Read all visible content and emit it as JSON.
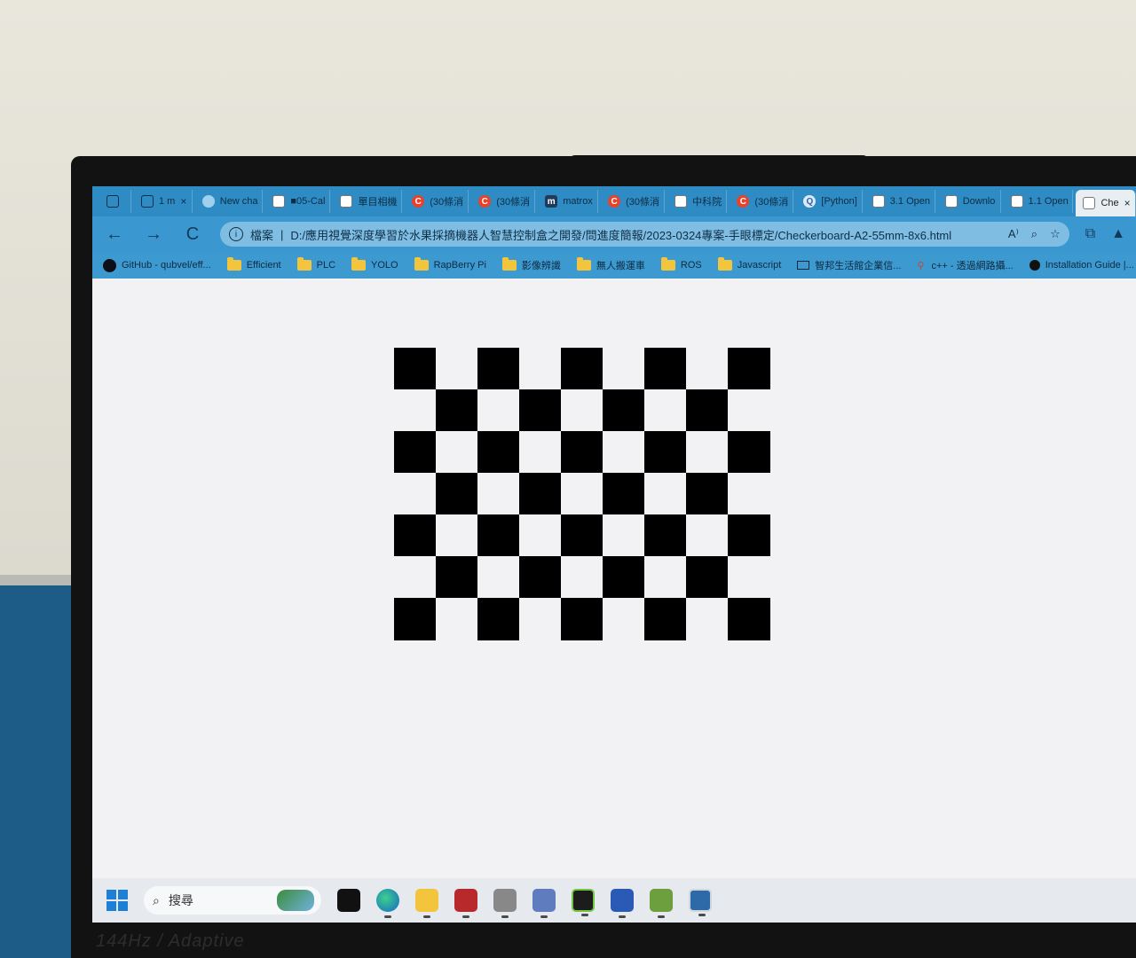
{
  "browser": {
    "tabs": [
      {
        "label": "",
        "icon": "window-switcher-icon",
        "active": false
      },
      {
        "label": "1 m",
        "icon": "book-icon",
        "active": false,
        "closable": true
      },
      {
        "label": "New cha",
        "icon": "globe-icon",
        "active": false
      },
      {
        "label": "■05-Cal",
        "icon": "document-icon",
        "active": false
      },
      {
        "label": "單目相機",
        "icon": "document-icon",
        "active": false
      },
      {
        "label": "(30條消",
        "icon": "csdn-icon",
        "active": false
      },
      {
        "label": "(30條消",
        "icon": "csdn-icon",
        "active": false
      },
      {
        "label": "matrox",
        "icon": "m-icon",
        "active": false
      },
      {
        "label": "(30條消",
        "icon": "csdn-icon",
        "active": false
      },
      {
        "label": "中科院",
        "icon": "document-icon",
        "active": false
      },
      {
        "label": "(30條消",
        "icon": "csdn-icon",
        "active": false
      },
      {
        "label": "[Python]",
        "icon": "q-icon",
        "active": false
      },
      {
        "label": "3.1 Open",
        "icon": "page-icon",
        "active": false
      },
      {
        "label": "Downlo",
        "icon": "page-icon",
        "active": false
      },
      {
        "label": "1.1 Open",
        "icon": "page-icon",
        "active": false
      },
      {
        "label": "Che",
        "icon": "document-icon",
        "active": true,
        "closable": true
      }
    ],
    "toolbar": {
      "back_icon": "←",
      "forward_icon": "→",
      "reload_icon": "C",
      "info_icon": "i",
      "scheme": "檔案",
      "separator": "|",
      "url": "D:/應用視覺深度學習於水果採摘機器人智慧控制盒之開發/問進度簡報/2023-0324專案-手眼標定/Checkerboard-A2-55mm-8x6.html",
      "read_aloud_icon": "A⁾",
      "zoom_icon": "⌕",
      "favorite_icon": "☆",
      "collections_icon": "⧉",
      "profile_icon": "▲"
    },
    "bookmarks": [
      {
        "label": "GitHub - qubvel/eff...",
        "icon": "github-icon"
      },
      {
        "label": "Efficient",
        "icon": "folder-icon"
      },
      {
        "label": "PLC",
        "icon": "folder-icon"
      },
      {
        "label": "YOLO",
        "icon": "folder-icon"
      },
      {
        "label": "RapBerry Pi",
        "icon": "folder-icon"
      },
      {
        "label": "影像辨識",
        "icon": "folder-icon"
      },
      {
        "label": "無人搬運車",
        "icon": "folder-icon"
      },
      {
        "label": "ROS",
        "icon": "folder-icon"
      },
      {
        "label": "Javascript",
        "icon": "folder-icon"
      },
      {
        "label": "智邦生活館企業信...",
        "icon": "mail-icon"
      },
      {
        "label": "c++ - 透過網路攝...",
        "icon": "pin-icon"
      },
      {
        "label": "Installation Guide |...",
        "icon": "dot-icon"
      }
    ]
  },
  "checkerboard": {
    "rows": 7,
    "cols": 9,
    "colors": {
      "dark": "#000000",
      "light": "#f2f2f4"
    }
  },
  "taskbar": {
    "search_placeholder": "搜尋",
    "apps": [
      {
        "name": "task-view-app",
        "style": "app-black"
      },
      {
        "name": "edge-app",
        "style": "app-edge"
      },
      {
        "name": "file-explorer-app",
        "style": "app-files"
      },
      {
        "name": "red-app",
        "style": "app-red"
      },
      {
        "name": "grey-app",
        "style": "app-grey"
      },
      {
        "name": "network-app",
        "style": "app-net"
      },
      {
        "name": "pycharm-app",
        "style": "app-pc"
      },
      {
        "name": "word-app",
        "style": "app-word"
      },
      {
        "name": "tool-app",
        "style": "app-tool"
      },
      {
        "name": "picture-app",
        "style": "app-pic"
      }
    ]
  },
  "monitor": {
    "badge_text": "144Hz / Adaptive"
  }
}
